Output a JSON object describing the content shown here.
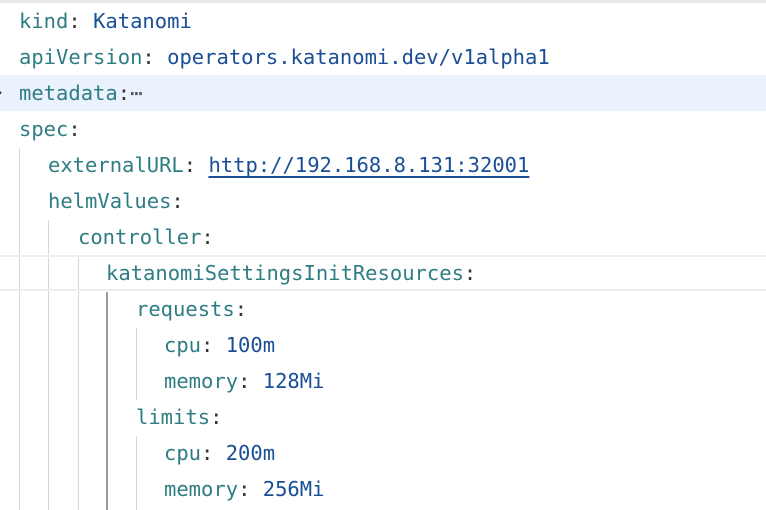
{
  "editor": {
    "lines": [
      {
        "key": "kind",
        "value": "Katanomi"
      },
      {
        "key": "apiVersion",
        "value": "operators.katanomi.dev/v1alpha1"
      },
      {
        "key": "metadata",
        "folded_marker": "⋯"
      },
      {
        "key": "spec"
      },
      {
        "key": "externalURL",
        "value": "http://192.168.8.131:32001"
      },
      {
        "key": "helmValues"
      },
      {
        "key": "controller"
      },
      {
        "key": "katanomiSettingsInitResources"
      },
      {
        "key": "requests"
      },
      {
        "key": "cpu",
        "value": "100m"
      },
      {
        "key": "memory",
        "value": "128Mi"
      },
      {
        "key": "limits"
      },
      {
        "key": "cpu",
        "value": "200m"
      },
      {
        "key": "memory",
        "value": "256Mi"
      }
    ],
    "fold_icon": "chevron-right-icon",
    "colors": {
      "key": "#2f7d84",
      "value": "#1a4e96",
      "folded_line_bg": "#eaf2fd"
    }
  }
}
